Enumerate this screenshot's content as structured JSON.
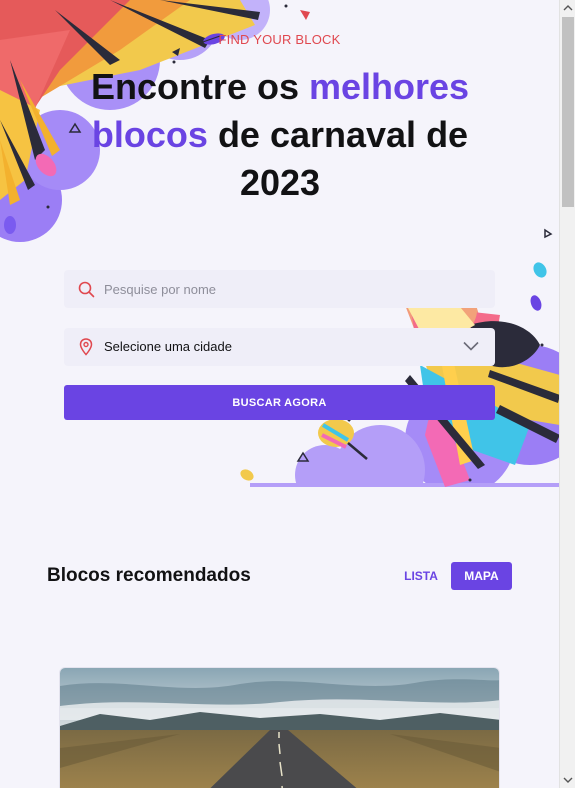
{
  "hero": {
    "eyebrow": "FIND YOUR BLOCK",
    "title_part1": "Encontre os ",
    "title_accent1": "melhores",
    "title_accent2": "blocos",
    "title_part2": " de carnaval de 2023"
  },
  "search": {
    "placeholder": "Pesquise por nome",
    "value": "",
    "icon": "search-icon"
  },
  "city_select": {
    "selected": "Selecione uma cidade",
    "icon": "map-pin-icon",
    "chevron": "chevron-down-icon"
  },
  "cta": {
    "label": "BUSCAR AGORA"
  },
  "recommended": {
    "title": "Blocos recomendados",
    "view_list": "LISTA",
    "view_map": "MAPA",
    "active_view": "MAPA"
  },
  "colors": {
    "accent": "#6a44e3",
    "eyebrow": "#e0484f",
    "background": "#f5f4fb",
    "field": "#efeef8"
  }
}
